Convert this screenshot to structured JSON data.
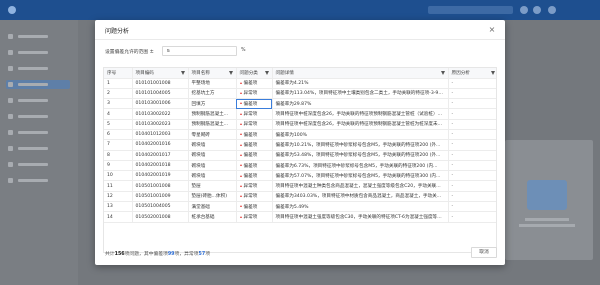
{
  "modal": {
    "title": "问题分析",
    "close_glyph": "×",
    "range": {
      "label": "设置偏差允许的范围 ±",
      "value": "5",
      "unit": "%"
    },
    "columns": [
      "序号",
      "项目编码",
      "项目名称",
      "问题分类",
      "问题详情",
      "原因分析"
    ],
    "rows": [
      {
        "no": "1",
        "code": "010101001008",
        "name": "平整场地",
        "class": "偏差项",
        "detail": "偏差率为4.21%",
        "analysis": "-"
      },
      {
        "no": "2",
        "code": "010101004005",
        "name": "挖基坑土方",
        "class": "异常项",
        "detail": "偏差率为113.04%，项目特征项中土壤类别包含二类土，手动关联的特征项-3-9为...",
        "analysis": "-"
      },
      {
        "no": "3",
        "code": "010103001006",
        "name": "回填方",
        "class": "偏差项",
        "detail": "偏差率为29.87%",
        "analysis": "-"
      },
      {
        "no": "4",
        "code": "010103002022",
        "name": "预制钢筋混凝土...",
        "class": "异常项",
        "detail": "项目特征项中桩深度包含26，手动关联的特征项预制钢筋混凝土管桩（试验桩）为...",
        "analysis": "-"
      },
      {
        "no": "5",
        "code": "010103002023",
        "name": "预制钢筋混凝土...",
        "class": "异常项",
        "detail": "项目特征项中桩深度包含26，手动关联的特征项预制钢筋混凝土管桩为桩深度未定...",
        "analysis": "-"
      },
      {
        "no": "6",
        "code": "010401012003",
        "name": "零星砌砖",
        "class": "偏差项",
        "detail": "偏差率为100%",
        "analysis": "-"
      },
      {
        "no": "7",
        "code": "010402001016",
        "name": "砌块墙",
        "class": "偏差项",
        "detail": "偏差率为10.21%，项目特征项中砂浆标号包含M5，手动关联的特征项200 (外...",
        "analysis": "-"
      },
      {
        "no": "8",
        "code": "010402001017",
        "name": "砌块墙",
        "class": "偏差项",
        "detail": "偏差率为53.48%，项目特征项中砂浆标号包含M5，手动关联的特征项200 (外...",
        "analysis": "-"
      },
      {
        "no": "9",
        "code": "010402001018",
        "name": "砌块墙",
        "class": "偏差项",
        "detail": "偏差率为6.73%，项目特征项中砂浆标号包含M5，手动关联的特征项200 (内...",
        "analysis": "-"
      },
      {
        "no": "10",
        "code": "010402001019",
        "name": "砌块墙",
        "class": "偏差项",
        "detail": "偏差率为57.07%，项目特征项中砂浆标号包含M5，手动关联的特征项300 (内...",
        "analysis": "-"
      },
      {
        "no": "11",
        "code": "010501001008",
        "name": "垫层",
        "class": "异常项",
        "detail": "项目特征项中混凝土种类包含商品混凝土，混凝土强度等级包含C20，手动关联的...",
        "analysis": "-"
      },
      {
        "no": "12",
        "code": "010501001009",
        "name": "垫层(砖胎...体积)",
        "class": "异常项",
        "detail": "偏差率为3403.03%，项目特征项中材质包含商品混凝土，商品混凝土，手动关...",
        "analysis": "-"
      },
      {
        "no": "13",
        "code": "010501004005",
        "name": "满堂基础",
        "class": "偏差项",
        "detail": "偏差率为5.49%",
        "analysis": "-"
      },
      {
        "no": "14",
        "code": "010502001008",
        "name": "桩承台基础",
        "class": "异常项",
        "detail": "项目特征项中混凝土强度等级包含C30，手动关联的特征项CT-6为混凝土强度等级...",
        "analysis": "-"
      }
    ],
    "summary": {
      "prefix": "共计",
      "total": "156",
      "mid1": "项问题，其中偏差项",
      "deviation": "99",
      "mid2": "项，异常项",
      "abnormal": "57",
      "suffix": "项"
    },
    "cancel_label": "取消"
  },
  "colors": {
    "accent": "#2f6fd6",
    "abnormal_marker": "#e53935",
    "header_bar": "#1e4f8f"
  }
}
